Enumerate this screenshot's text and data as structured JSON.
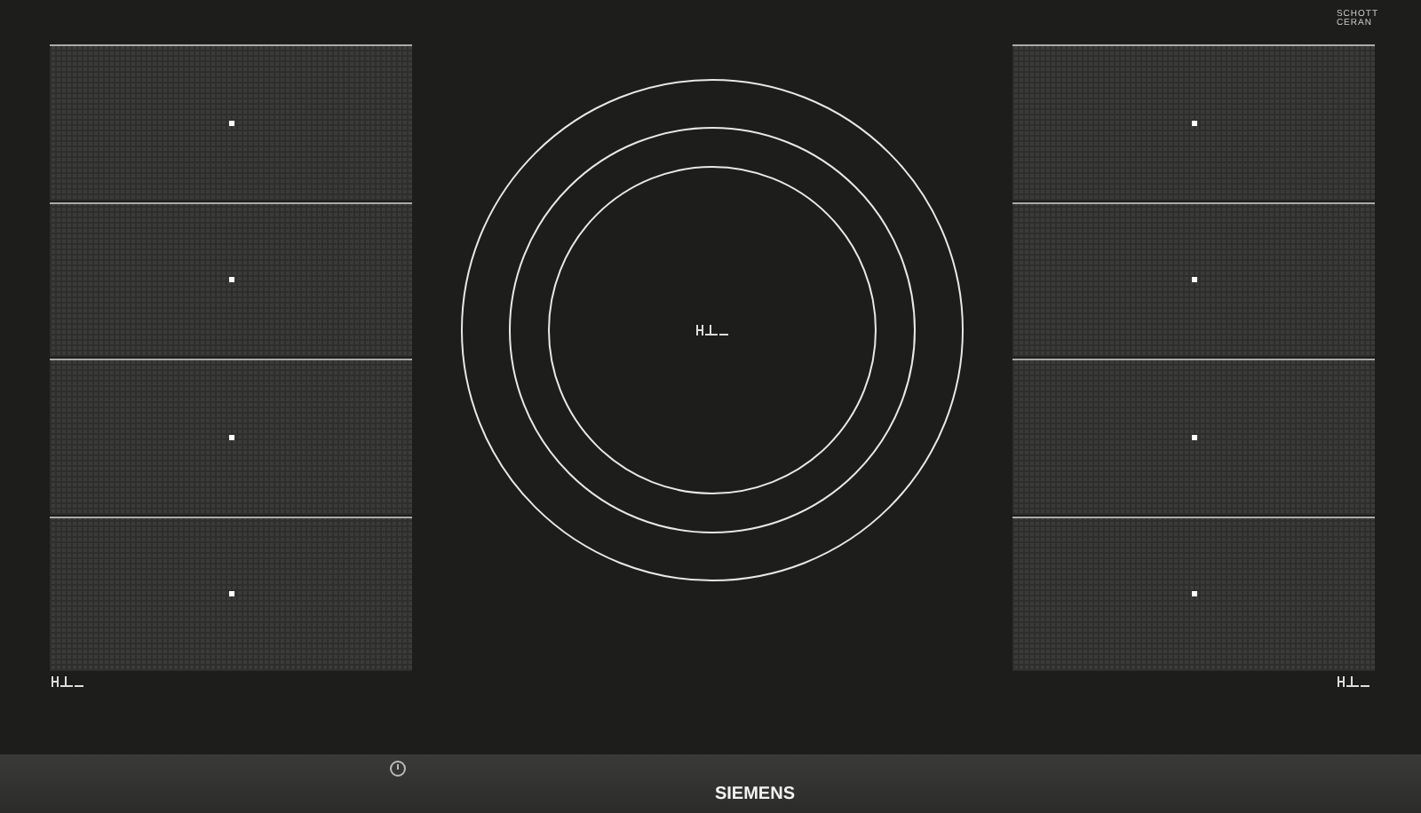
{
  "glass_brand": [
    "SCHOTT",
    "CERAN"
  ],
  "control_bar": {
    "brand": "SIEMENS"
  }
}
